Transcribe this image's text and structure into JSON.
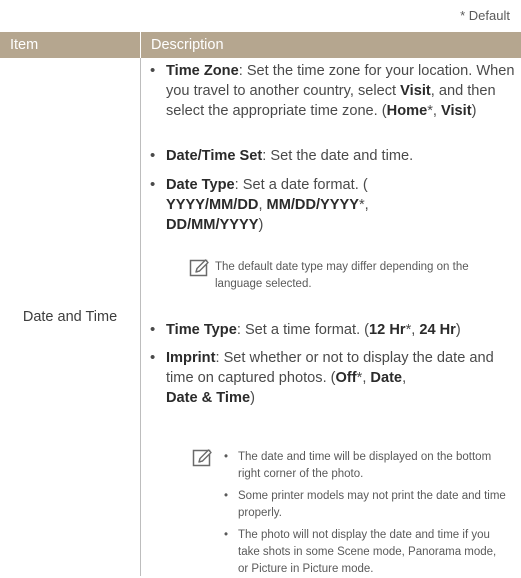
{
  "default_note": "* Default",
  "header": {
    "item": "Item",
    "description": "Description"
  },
  "row": {
    "item": "Date and Time",
    "tz": {
      "label": "Time Zone",
      "t1": ": Set the time zone for your location. When you travel to another country, select ",
      "visit": "Visit",
      "t2": ", and then select the appropriate time zone. (",
      "home": "Home",
      "star": "*",
      "sep": ", ",
      "visit2": "Visit",
      "close": ")"
    },
    "dts": {
      "label": "Date/Time Set",
      "text": ": Set the date and time."
    },
    "dtype": {
      "label": "Date Type",
      "t1": ": Set a date format. (",
      "o1": "YYYY/MM/DD",
      "sep1": ", ",
      "o2": "MM/DD/YYYY",
      "star": "*",
      "sep2": ",",
      "o3": "DD/MM/YYYY",
      "close": ")"
    },
    "note1": "The default date type may differ depending on the language selected.",
    "ttype": {
      "label": "Time Type",
      "t1": ": Set a time format. (",
      "o1": "12 Hr",
      "star": "*",
      "sep": ", ",
      "o2": "24 Hr",
      "close": ")"
    },
    "imprint": {
      "label": "Imprint",
      "t1": ": Set whether or not to display the date and time on captured photos. (",
      "o1": "Off",
      "star": "*",
      "sep1": ", ",
      "o2": "Date",
      "sep2": ",",
      "o3": "Date & Time",
      "close": ")"
    },
    "note2": [
      "The date and time will be displayed on the bottom right corner of the photo.",
      "Some printer models may not print the date and time properly.",
      "The photo will not display the date and time if you take shots in some Scene mode, Panorama mode, or Picture in Picture mode."
    ],
    "note_icon": "pencil-note-icon",
    "bullet_char": "•"
  },
  "colors": {
    "header_bg": "#b5a68f",
    "header_text": "#ffffff",
    "body_text": "#4a4a4a",
    "divider": "#bdbdbd"
  }
}
